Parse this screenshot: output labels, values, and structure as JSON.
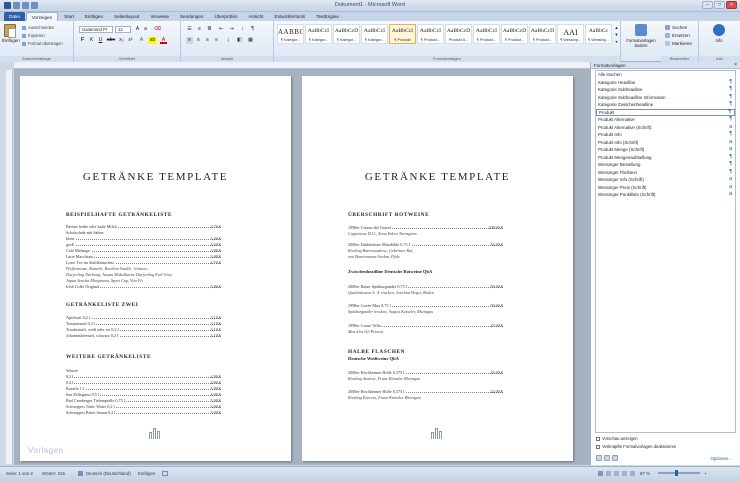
{
  "window": {
    "title": "Dokument1 - Microsoft Word",
    "close": "×",
    "max": "□",
    "min": "–"
  },
  "tabs": [
    "Datei",
    "Vorzeigen",
    "Start",
    "Einfügen",
    "Seitenlayout",
    "Verweise",
    "Sendungen",
    "Überprüfen",
    "Ansicht",
    "Entwicklertools",
    "TextEngine"
  ],
  "ribbon": {
    "paste": "Einfügen",
    "clipboard_items": [
      "Ausschneiden",
      "Kopieren",
      "Format übertragen"
    ],
    "group_labels": [
      "Zwischenablage",
      "Schriftart",
      "Absatz",
      "Formatvorlagen",
      "Bearbeiten",
      "Info"
    ],
    "font_name": "Garamond Pr",
    "font_size": "12",
    "font_buttons": [
      "F",
      "K",
      "U",
      "abe",
      "x₂",
      "x²",
      "A",
      "ab",
      "A"
    ],
    "style_samples": [
      "AABBC",
      "AaBbCcI",
      "AaBbCcD",
      "AaBbCcI",
      "AaBbCcI",
      "AaBbCcI",
      "AaBbCcD",
      "AaBbCcI",
      "AaBbCcD",
      "AaBbCcD",
      "AaBbCcD",
      "AaBbCcI",
      "AAI",
      "AaBbCc"
    ],
    "style_names": [
      "¶ Kategor...",
      "¶ Kategor...",
      "¶ Kategor...",
      "¶ Kategor...",
      "¶ Produkt",
      "¶ Produkt...",
      "Produkt A...",
      "¶ Produkt...",
      "¶ Produkt...",
      "¶ Produkt...",
      "¶ Produkt...",
      "¶ Wessing...",
      "¶ Wessing..."
    ],
    "change_styles": "Formatvorlagen ändern",
    "edit_items": [
      "Suchen",
      "Ersetzen",
      "Markieren"
    ],
    "info": "Info"
  },
  "left_page": {
    "title": "GETRÄNKE TEMPLATE",
    "sections": [
      {
        "heading": "BEISPIELHAFTE GETRÄNKELISTE",
        "rows": [
          {
            "name": "Becher heiße oder kalte Milch",
            "price": "2,70 €"
          },
          {
            "name": "Schokolade mit Sahne",
            "price": ""
          },
          {
            "name": "klein",
            "price": "3,40 €"
          },
          {
            "name": "groß",
            "price": "4,60 €"
          },
          {
            "name": "Café Malange",
            "price": "3,80 €"
          },
          {
            "name": "Latte Macchiato",
            "price": "3,90 €"
          },
          {
            "name": "Loser Tee im Stahlkännchen",
            "price": "4,70 €"
          }
        ],
        "notes": [
          "Pfefferminze, Kamille, Rooibos-Vanille, Grüntee,",
          "Darjeeling Nurbong, Assam Mokalbaria, Darjeeling Earl Grey,",
          "Japan Sencha Morgentau, Sport Cup, Vita Fit"
        ],
        "tail": {
          "name": "Irish Coffe Original",
          "price": "5,80 €"
        }
      },
      {
        "heading": "GETRÄNKELISTE ZWEI",
        "rows": [
          {
            "name": "Apfelsaft 0,2 l",
            "price": "3,10 €"
          },
          {
            "name": "Tomatensaft 0,2 l",
            "price": "3,10 €"
          },
          {
            "name": "Traubensaft, weiß oder rot 0,2 l",
            "price": "3,10 €"
          },
          {
            "name": "Johannisbeersaft, schwarz 0,2 l",
            "price": "3,10 €"
          }
        ]
      },
      {
        "heading": "WEITERE GETRÄNKELISTE",
        "rows": [
          {
            "name": "Wasser",
            "price": ""
          },
          {
            "name": "0,2 l",
            "price": "2,90 €"
          },
          {
            "name": "0,4 l",
            "price": "4,90 €"
          },
          {
            "name": "Karaffe 1 l",
            "price": "5,90 €"
          },
          {
            "name": "San Pellegrino 0,5 l",
            "price": "4,90 €"
          },
          {
            "name": "Bad Camberger Tiefenquelle 0,75 l",
            "price": "5,90 €"
          },
          {
            "name": "Schweppes Tonic Water 0,2 l",
            "price": "3,00 €"
          },
          {
            "name": "Schweppes Bitter lemon 0,2 l",
            "price": "3,00 €"
          }
        ]
      }
    ],
    "watermark": "Vorlagen"
  },
  "right_page": {
    "title": "GETRÄNKE TEMPLATE",
    "s1": "ÜBERSCHRIFT ROTWEINE",
    "r1": [
      {
        "name": "1998er Coteau del Grazel",
        "price": "108,00 €",
        "note": "Cagueneux D.O., Zona Edoot Tarragona"
      },
      {
        "name": "2000er Dürkheimer Mitzdöble 0,75 l",
        "price": "52,00 €",
        "note": "Riesling Barrenauslese, Gebeimer Rat,"
      },
      {
        "name": "",
        "price": "",
        "note": "von Bassermann-Jordan, Pfalz"
      }
    ],
    "s2": "Zwischenheadline Deutsche Rotweine QbA",
    "r2": [
      {
        "name": "2000er Bauer Spätburgunder 0,75 l",
        "price": "59,00 €",
        "note": "Qualitätswein b. A. trocken, Joachim Heger, Baden"
      },
      {
        "name": "1998er Cuvée Max 0,75 l",
        "price": "59,00 €",
        "note": "Spätburgunder trocken, August Kesseler, Rheingau"
      },
      {
        "name": "1998er Corno Vella",
        "price": "27,00 €",
        "note": "Mas d'en Gil Priorat"
      }
    ],
    "s3": "HALBE FLASCHEN",
    "s3sub": "Deutsche Weißweine QbA",
    "r3": [
      {
        "name": "2000er Hochheimer Hölle 0,375 l",
        "price": "23,00 €",
        "note": "Riesling Auslese, Franz Künstler Rheingau"
      },
      {
        "name": "2000er Hochheimer Hölle 0,375 l",
        "price": "22,00 €",
        "note": "Riesling Eiswein, Franz Künstler Rheingau"
      }
    ]
  },
  "pane": {
    "title": "Formatvorlagen",
    "items": [
      "Alle löschen",
      "Kategorie Headline",
      "Kategorie Subheadline",
      "Kategorie Subheadline Information",
      "Kategorie Zwischenheadline",
      "Produkt",
      "Produkt Alternative",
      "Produkt Alternative (Schrift)",
      "Produkt Info",
      "Produkt Info (Schrift)",
      "Produkt Menge (Schrift)",
      "Produkt Mengenaufstellung",
      "Wessinger Bestellung",
      "Wessinger Fließtext",
      "Wessinger Info (Schrift)",
      "Wessinger Preis (Schrift)",
      "Wessinger Punktliste (Schrift)"
    ],
    "marks": [
      "",
      "¶",
      "¶",
      "¶",
      "¶",
      "¶",
      "¶",
      "a",
      "¶",
      "a",
      "a",
      "¶",
      "¶",
      "¶",
      "a",
      "a",
      "a"
    ],
    "preview": "Vorschau anzeigen",
    "linked": "Verknüpfte Formatvorlagen deaktivieren",
    "options": "Optionen..."
  },
  "status": {
    "page": "Seite: 1 von 2",
    "words": "Wörter: 215",
    "lang": "Deutsch (Deutschland)",
    "mode": "Einfügen",
    "zoom": "87 %"
  }
}
